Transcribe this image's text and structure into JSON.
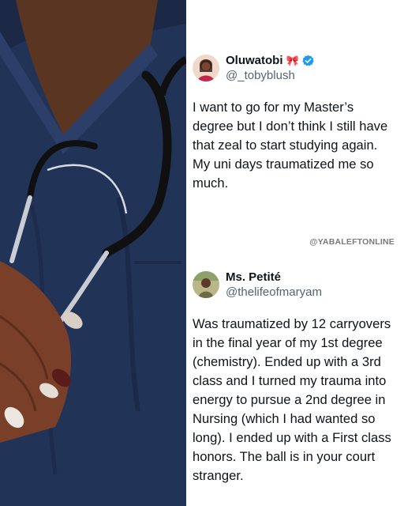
{
  "tweets": [
    {
      "name": "Oluwatobi",
      "name_emoji": "🎀",
      "handle": "@_tobyblush",
      "text": "I want to go for my Master’s degree but I don’t think I still have that zeal to start studying again. My uni days traumatized me so much.",
      "verified": true
    },
    {
      "name": "Ms. Petité",
      "handle": "@thelifeofmaryam",
      "text": "Was traumatized by 12 carryovers in the final year of my 1st degree (chemistry). Ended up with a 3rd class and I turned my trauma into energy to pursue a 2nd degree in Nursing (which I had wanted so long). I ended up with a First class honors. The ball is in your court stranger."
    }
  ],
  "watermark": "@YABALEFTONLINE"
}
